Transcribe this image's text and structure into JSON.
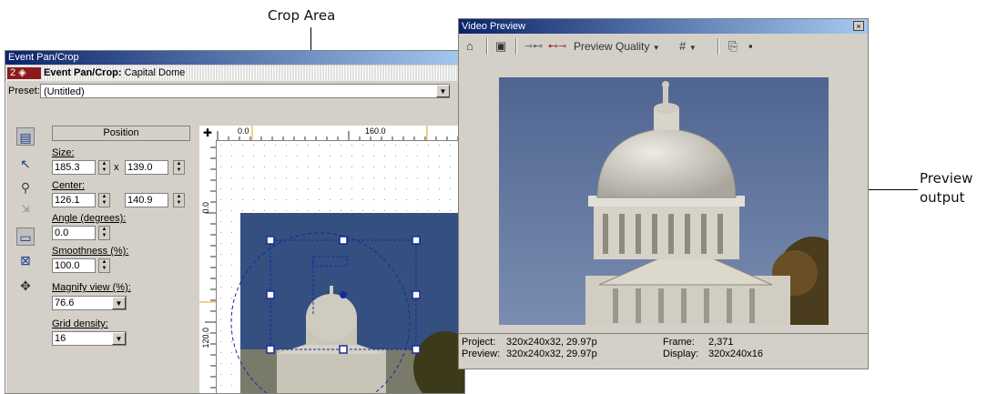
{
  "callouts": {
    "crop_area": "Crop Area",
    "preview_output_line1": "Preview",
    "preview_output_line2": "output"
  },
  "event_pan_crop": {
    "window_title": "Event Pan/Crop",
    "badge_number": "2",
    "header_title": "Event Pan/Crop:",
    "header_subject": "Capital Dome",
    "preset_label": "Preset:",
    "preset_value": "(Untitled)",
    "position_tab": "Position",
    "size_label": "Size:",
    "size_width": "185.3",
    "size_x": "x",
    "size_height": "139.0",
    "center_label": "Center:",
    "center_x": "126.1",
    "center_y": "140.9",
    "angle_label": "Angle (degrees):",
    "angle_value": "0.0",
    "smoothness_label": "Smoothness (%):",
    "smoothness_value": "100.0",
    "magnify_label": "Magnify view (%):",
    "magnify_value": "76.6",
    "grid_label": "Grid density:",
    "grid_value": "16",
    "ruler_top_0": "0.0",
    "ruler_top_160": "160.0",
    "ruler_left_0": "0.0",
    "ruler_left_120": "120.0"
  },
  "video_preview": {
    "window_title": "Video Preview",
    "close_glyph": "×",
    "preview_quality_label": "Preview Quality",
    "status": {
      "project_label": "Project:",
      "project_value": "320x240x32, 29.97p",
      "preview_label": "Preview:",
      "preview_value": "320x240x32, 29.97p",
      "frame_label": "Frame:",
      "frame_value": "2,371",
      "display_label": "Display:",
      "display_value": "320x240x16"
    }
  },
  "icons": [
    "properties-icon",
    "overlay-icon",
    "split-screen-icon",
    "external-monitor-icon",
    "grid-icon",
    "copy-snapshot-icon",
    "save-snapshot-icon",
    "normal-edit-icon",
    "zoom-icon",
    "sync-cursor-icon",
    "lock-aspect-icon",
    "scale-about-center-icon",
    "move-icon",
    "crosshair-icon"
  ],
  "colors": {
    "titlebar_start": "#0a246a",
    "titlebar_end": "#a6caf0",
    "crop_handle": "#1a2a9a",
    "badge": "#8b1c1c"
  }
}
